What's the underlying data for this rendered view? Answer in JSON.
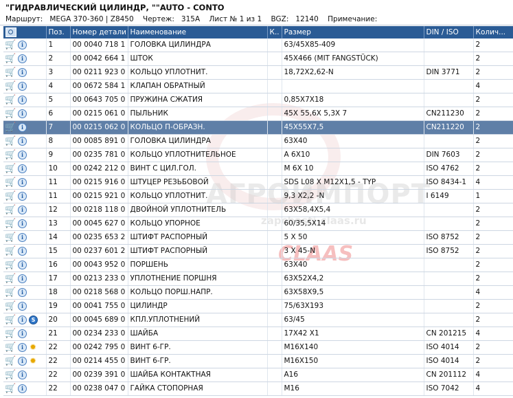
{
  "header": {
    "title": "\"ГИДРАВЛИЧЕСКИЙ ЦИЛИНДР, \"\"AUTO - CONTO",
    "route_label": "Маршрут:",
    "route_value": "MEGA 370-360 | Z8450",
    "drawing_label": "Чертеж:",
    "drawing_value": "315A",
    "sheet": "Лист № 1 из 1",
    "bgz_label": "BGZ:",
    "bgz_value": "12140",
    "note_label": "Примечание:"
  },
  "columns": {
    "pos": "Поз.",
    "part": "Номер детали",
    "name": "Наименование",
    "k": "К..",
    "size": "Размер",
    "din": "DIN / ISO",
    "qty": "Колич..."
  },
  "watermark": {
    "main": "АГРОИМПОРТ",
    "sub": "zapchasti-claas.ru",
    "brand": "CLAAS"
  },
  "rows": [
    {
      "pos": "1",
      "part": "00 0040 718 1",
      "name": "ГОЛОВКА ЦИЛИНДРА",
      "size": "63/45X85-409",
      "din": "",
      "qty": "2",
      "icons": [
        "cart",
        "info"
      ]
    },
    {
      "pos": "2",
      "part": "00 0042 664 1",
      "name": "ШТОК",
      "size": "45X466 (MIT FANGSTÜCK)",
      "din": "",
      "qty": "2",
      "icons": [
        "cart",
        "info"
      ]
    },
    {
      "pos": "3",
      "part": "00 0211 923 0",
      "name": "КОЛЬЦО УПЛОТНИТ.",
      "size": "18,72X2,62-N",
      "din": "DIN 3771",
      "qty": "2",
      "icons": [
        "cart",
        "info"
      ]
    },
    {
      "pos": "4",
      "part": "00 0672 584 1",
      "name": "КЛАПАН ОБРАТНЫЙ",
      "size": "",
      "din": "",
      "qty": "4",
      "icons": [
        "cart",
        "info"
      ]
    },
    {
      "pos": "5",
      "part": "00 0643 705 0",
      "name": "ПРУЖИНА СЖАТИЯ",
      "size": "0,85X7X18",
      "din": "",
      "qty": "2",
      "icons": [
        "cart",
        "info"
      ]
    },
    {
      "pos": "6",
      "part": "00 0215 061 0",
      "name": "ПЫЛЬНИК",
      "size": "45X 55,6X 5,3X 7",
      "din": "CN211230",
      "qty": "2",
      "icons": [
        "cart",
        "info"
      ]
    },
    {
      "pos": "7",
      "part": "00 0215 062 0",
      "name": "КОЛЬЦО П-ОБРАЗН.",
      "size": "45X55X7,5",
      "din": "CN211220",
      "qty": "2",
      "icons": [
        "cart",
        "info"
      ],
      "selected": true
    },
    {
      "pos": "8",
      "part": "00 0085 891 0",
      "name": "ГОЛОВКА ЦИЛИНДРА",
      "size": "63X40",
      "din": "",
      "qty": "2",
      "icons": [
        "cart",
        "info"
      ]
    },
    {
      "pos": "9",
      "part": "00 0235 781 0",
      "name": "КОЛЬЦО УПЛОТНИТЕЛЬНОЕ",
      "size": "A 6X10",
      "din": "DIN 7603",
      "qty": "2",
      "icons": [
        "cart",
        "info"
      ]
    },
    {
      "pos": "10",
      "part": "00 0242 212 0",
      "name": "ВИНТ С ЦИЛ.ГОЛ.",
      "size": "M 6X 10",
      "din": "ISO 4762",
      "qty": "2",
      "icons": [
        "cart",
        "info"
      ]
    },
    {
      "pos": "11",
      "part": "00 0215 916 0",
      "name": "ШТУЦЕР РЕЗЬБОВОЙ",
      "size": "SDS L08 X M12X1,5 - TYP",
      "din": "ISO 8434-1",
      "qty": "4",
      "icons": [
        "cart",
        "info"
      ]
    },
    {
      "pos": "11",
      "part": "00 0215 921 0",
      "name": "КОЛЬЦО УПЛОТНИТ.",
      "size": "9,3 X2,2 -N",
      "din": "I 6149",
      "qty": "1",
      "icons": [
        "cart",
        "info"
      ]
    },
    {
      "pos": "12",
      "part": "00 0218 118 0",
      "name": "ДВОЙНОЙ УПЛОТНИТЕЛЬ",
      "size": "63X58,4X5,4",
      "din": "",
      "qty": "2",
      "icons": [
        "cart",
        "info"
      ]
    },
    {
      "pos": "13",
      "part": "00 0045 627 0",
      "name": "КОЛЬЦО УПОРНОЕ",
      "size": "60/35,5X14",
      "din": "",
      "qty": "2",
      "icons": [
        "cart",
        "info"
      ]
    },
    {
      "pos": "14",
      "part": "00 0235 653 2",
      "name": "ШТИФТ РАСПОРНЫЙ",
      "size": "5  X 50",
      "din": "ISO 8752",
      "qty": "2",
      "icons": [
        "cart",
        "info"
      ]
    },
    {
      "pos": "15",
      "part": "00 0237 601 2",
      "name": "ШТИФТ РАСПОРНЫЙ",
      "size": "3  X 45-N",
      "din": "ISO 8752",
      "qty": "2",
      "icons": [
        "cart",
        "info"
      ]
    },
    {
      "pos": "16",
      "part": "00 0043 952 0",
      "name": "ПОРШЕНЬ",
      "size": "63X40",
      "din": "",
      "qty": "2",
      "icons": [
        "cart",
        "info"
      ]
    },
    {
      "pos": "17",
      "part": "00 0213 233 0",
      "name": "УПЛОТНЕНИЕ ПОРШНЯ",
      "size": "63X52X4,2",
      "din": "",
      "qty": "2",
      "icons": [
        "cart",
        "info"
      ]
    },
    {
      "pos": "18",
      "part": "00 0218 568 0",
      "name": "КОЛЬЦО ПОРШ.НАПР.",
      "size": "63X58X9,5",
      "din": "",
      "qty": "4",
      "icons": [
        "cart",
        "info"
      ]
    },
    {
      "pos": "19",
      "part": "00 0041 755 0",
      "name": "ЦИЛИНДР",
      "size": "75/63X193",
      "din": "",
      "qty": "2",
      "icons": [
        "cart",
        "info"
      ]
    },
    {
      "pos": "20",
      "part": "00 0045 689 0",
      "name": "КПЛ.УПЛОТНЕНИЙ",
      "size": "63/45",
      "din": "",
      "qty": "2",
      "icons": [
        "cart",
        "info",
        "s"
      ]
    },
    {
      "pos": "21",
      "part": "00 0234 233 0",
      "name": "ШАЙБА",
      "size": "17X42 X1",
      "din": "CN 201215",
      "qty": "4",
      "icons": [
        "cart",
        "info"
      ]
    },
    {
      "pos": "22",
      "part": "00 0242 795 0",
      "name": "ВИНТ 6-ГР.",
      "size": "M16X140",
      "din": "ISO 4014",
      "qty": "2",
      "icons": [
        "cart",
        "info",
        "star"
      ]
    },
    {
      "pos": "22",
      "part": "00 0214 455 0",
      "name": "ВИНТ 6-ГР.",
      "size": "M16X150",
      "din": "ISO 4014",
      "qty": "2",
      "icons": [
        "cart",
        "info",
        "star"
      ]
    },
    {
      "pos": "22",
      "part": "00 0239 391 0",
      "name": "ШАЙБА КОНТАКТНАЯ",
      "size": "A16",
      "din": "CN 201112",
      "qty": "4",
      "icons": [
        "cart",
        "info"
      ]
    },
    {
      "pos": "22",
      "part": "00 0238 047 0",
      "name": "ГАЙКА СТОПОРНАЯ",
      "size": "M16",
      "din": "ISO 7042",
      "qty": "4",
      "icons": [
        "cart",
        "info"
      ]
    }
  ]
}
